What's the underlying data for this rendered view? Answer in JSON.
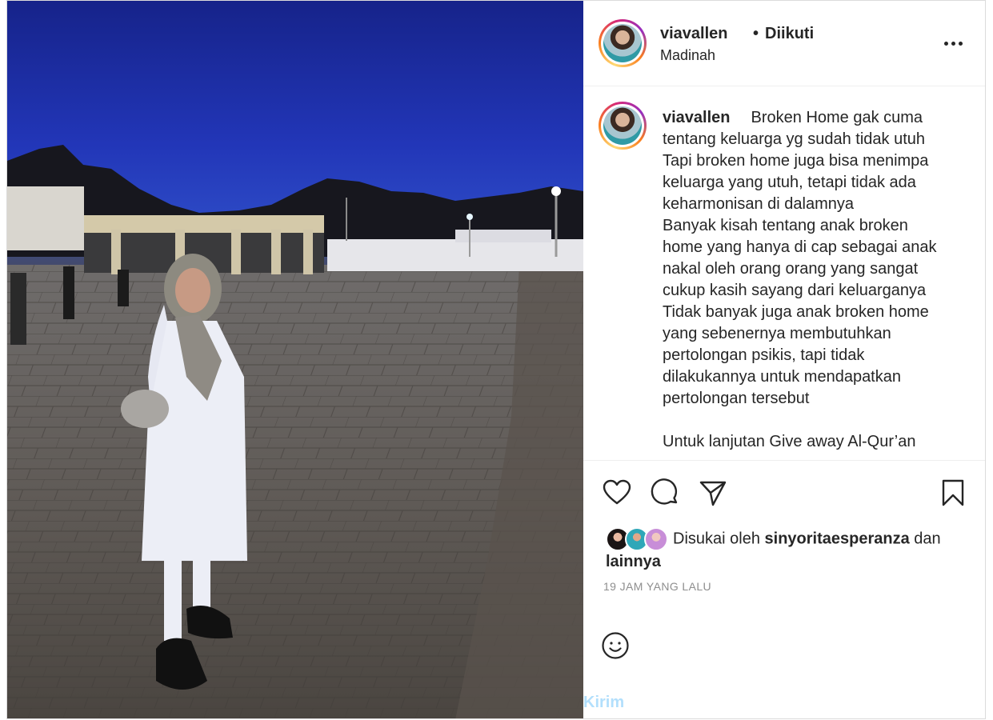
{
  "post": {
    "username": "viavallen",
    "follow_dot": "•",
    "follow_label": "Diikuti",
    "location": "Madinah",
    "more_icon": "more-horizontal-icon"
  },
  "caption": {
    "username": "viavallen",
    "text": "Broken Home gak cuma\ntentang keluarga yg sudah tidak utuh\nTapi broken home juga bisa menimpa\nkeluarga yang utuh, tetapi tidak ada\nkeharmonisan di dalamnya\nBanyak kisah tentang anak broken\nhome yang hanya di cap sebagai anak\nnakal oleh orang orang yang sangat\ncukup kasih sayang dari keluarganya\nTidak banyak juga anak broken home\nyang sebenernya membutuhkan\npertolongan psikis, tapi tidak\ndilakukannya untuk mendapatkan\npertolongan tersebut\n\nUntuk lanjutan Give away Al-Qur’an"
  },
  "actions": {
    "like_icon": "heart-icon",
    "comment_icon": "comment-icon",
    "share_icon": "send-icon",
    "save_icon": "bookmark-icon"
  },
  "likes": {
    "prefix": "Disukai oleh",
    "user": "sinyoritaesperanza",
    "connector": "dan",
    "others": "lainnya"
  },
  "timestamp": "19 JAM YANG LALU",
  "comment": {
    "emoji_icon": "smiley-icon",
    "send_label": "Kirim"
  },
  "colors": {
    "text": "#262626",
    "muted": "#8e8e8e",
    "send_disabled": "#b2dffc",
    "border": "#dbdbdb"
  }
}
